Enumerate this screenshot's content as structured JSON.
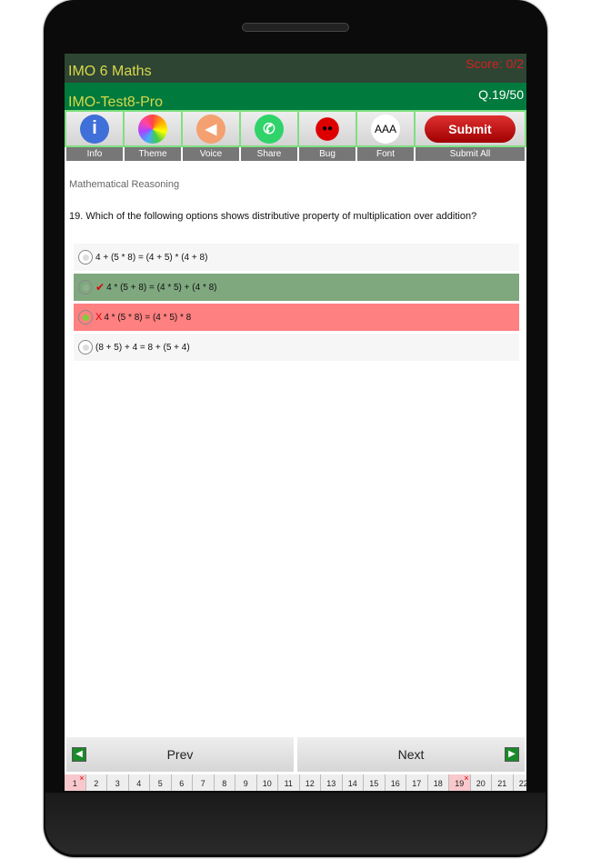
{
  "header": {
    "app_title": "IMO 6 Maths",
    "score": "Score: 0/2",
    "test_name": "IMO-Test8-Pro",
    "question_counter": "Q.19/50"
  },
  "toolbar": [
    {
      "label": "Info",
      "icon": "info-icon"
    },
    {
      "label": "Theme",
      "icon": "theme-icon"
    },
    {
      "label": "Voice",
      "icon": "speaker-icon"
    },
    {
      "label": "Share",
      "icon": "whatsapp-icon"
    },
    {
      "label": "Bug",
      "icon": "ladybug-icon"
    },
    {
      "label": "Font",
      "icon": "font-size-icon",
      "glyph": "AAA"
    }
  ],
  "submit": {
    "button": "Submit",
    "label": "Submit All"
  },
  "category": "Mathematical Reasoning",
  "question": "19. Which of the following options shows distributive property of multiplication over addition?",
  "options": [
    {
      "text": "4 + (5 * 8) = (4 + 5) * (4 + 8)",
      "state": "none"
    },
    {
      "text": "4 * (5 + 8) = (4 * 5) + (4 * 8)",
      "state": "correct"
    },
    {
      "text": "4 * (5 * 8) = (4 * 5) * 8",
      "state": "wrong-selected"
    },
    {
      "text": "(8 + 5) + 4 = 8 + (5 + 4)",
      "state": "none"
    }
  ],
  "colors": {
    "correct": "#7fa87f",
    "wrong": "#ff8080"
  },
  "nav": {
    "prev": "Prev",
    "next": "Next"
  },
  "question_numbers": [
    "1",
    "2",
    "3",
    "4",
    "5",
    "6",
    "7",
    "8",
    "9",
    "10",
    "11",
    "12",
    "13",
    "14",
    "15",
    "16",
    "17",
    "18",
    "19",
    "20",
    "21",
    "22"
  ],
  "wrong_questions": [
    "1",
    "19"
  ]
}
